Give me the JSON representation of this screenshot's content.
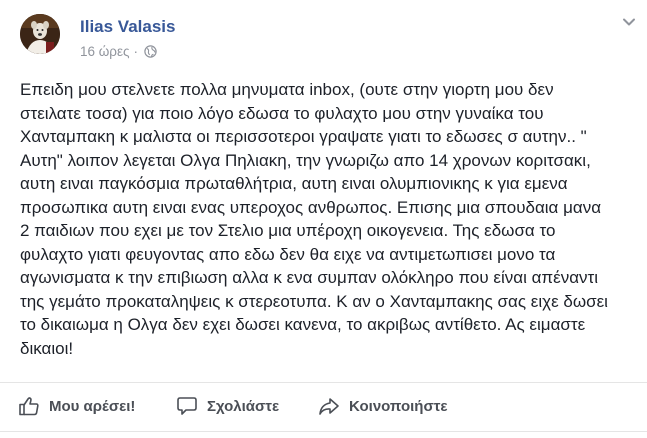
{
  "post": {
    "author_name": "Ilias Valasis",
    "timestamp": "16 ώρες",
    "separator": "·",
    "audience_icon": "globe-icon",
    "more_icon": "chevron-down-icon",
    "body_lines": [
      "Επειδη μου στελνετε πολλα μηνυματα inbox, (ουτε στην γιορτη μου δεν",
      "στειλατε τοσα) για ποιο λόγο εδωσα το φυλαχτο μου στην γυναίκα του",
      "Χανταμπακη κ μαλιστα οι περισσοτεροι γραψατε γιατι το εδωσες σ αυτην.. \"",
      "Αυτη\" λοιπον λεγεται Ολγα Πηλιακη, την γνωριζω απο 14 χρονων κοριτσακι,",
      "αυτη ειναι παγκόσμια πρωταθλήτρια, αυτη ειναι ολυμπιονικης κ για εμενα",
      "προσωπικα αυτη ειναι ενας υπεροχος ανθρωπος. Επισης μια σπουδαια μανα",
      "2 παιδιων που εχει με τον Στελιο μια υπέροχη οικογενεια. Της εδωσα το",
      "φυλαχτο γιατι φευγοντας απο εδω δεν θα ειχε να αντιμετωπισει μονο τα",
      "αγωνισματα κ την επιβιωση αλλα κ ενα συμπαν ολόκληρο που είναι απέναντι",
      "της γεμάτο προκαταληψεις κ στερεοτυπα. Κ αν ο Χανταμπακης σας ειχε δωσει",
      "το δικαιωμα η Ολγα δεν εχει δωσει κανενα, το ακριβως αντίθετο. Ας ειμαστε",
      "δικαιοι!"
    ]
  },
  "actions": {
    "like_label": "Μου αρέσει!",
    "like_icon": "thumbs-up-icon",
    "comment_label": "Σχολιάστε",
    "comment_icon": "comment-icon",
    "share_label": "Κοινοποιήστε",
    "share_icon": "share-icon"
  },
  "colors": {
    "author_link": "#385898",
    "meta_text": "#90949c",
    "body_text": "#1d2129",
    "action_text": "#4b4f56",
    "divider": "#e5e5e5"
  }
}
